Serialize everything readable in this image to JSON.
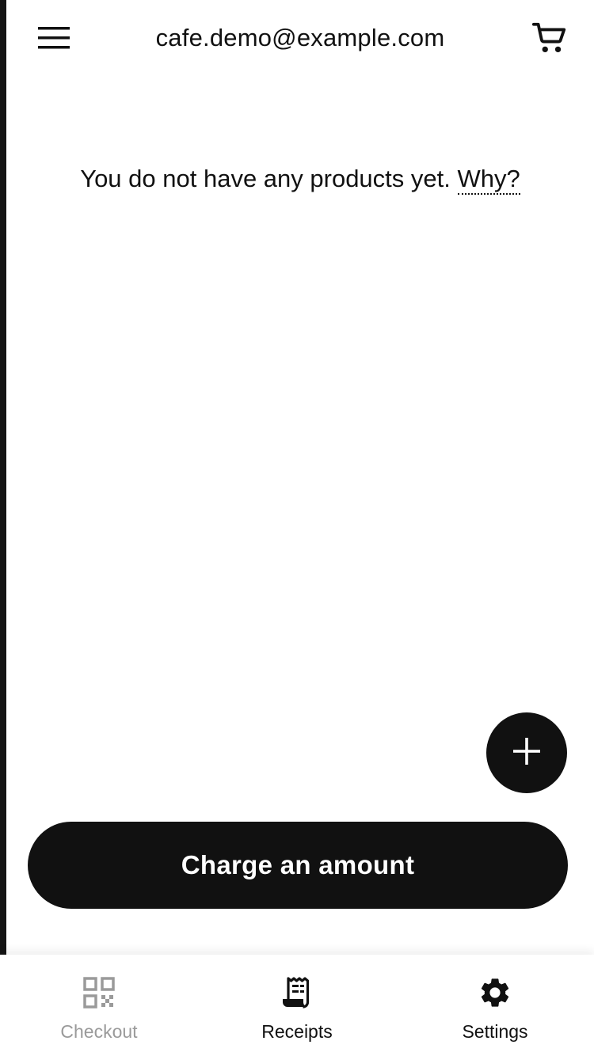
{
  "header": {
    "title": "cafe.demo@example.com",
    "menu_icon": "hamburger-menu-icon",
    "cart_icon": "shopping-cart-icon"
  },
  "main": {
    "empty_message": "You do not have any products yet.",
    "why_link": "Why?"
  },
  "fab": {
    "icon": "plus-icon"
  },
  "charge_button": {
    "label": "Charge an amount"
  },
  "bottom_nav": {
    "items": [
      {
        "label": "Checkout",
        "icon": "qr-code-icon",
        "state": "inactive"
      },
      {
        "label": "Receipts",
        "icon": "receipt-icon",
        "state": "active"
      },
      {
        "label": "Settings",
        "icon": "gear-icon",
        "state": "active"
      }
    ]
  },
  "colors": {
    "primary": "#111111",
    "background": "#ffffff",
    "inactive": "#9a9a9a"
  }
}
